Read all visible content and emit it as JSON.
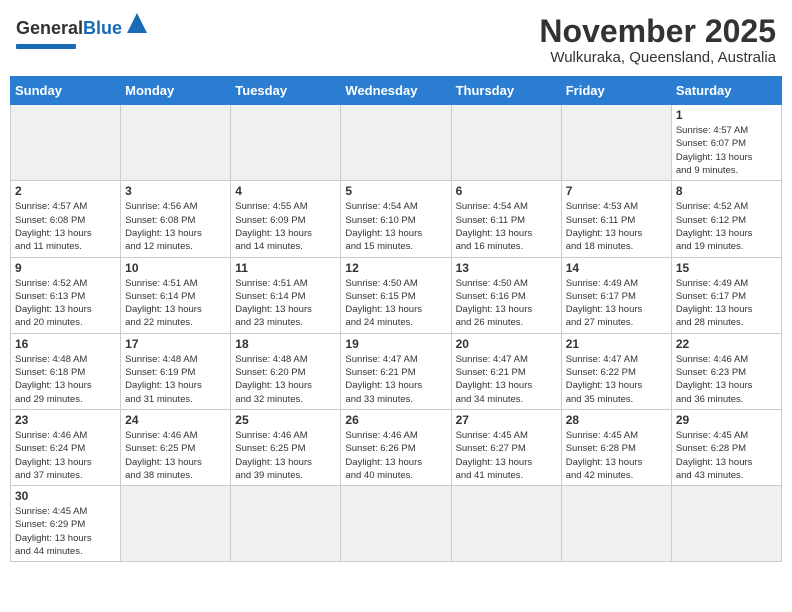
{
  "header": {
    "logo_general": "General",
    "logo_blue": "Blue",
    "month_title": "November 2025",
    "location": "Wulkuraka, Queensland, Australia"
  },
  "days_of_week": [
    "Sunday",
    "Monday",
    "Tuesday",
    "Wednesday",
    "Thursday",
    "Friday",
    "Saturday"
  ],
  "weeks": [
    [
      {
        "day": "",
        "empty": true
      },
      {
        "day": "",
        "empty": true
      },
      {
        "day": "",
        "empty": true
      },
      {
        "day": "",
        "empty": true
      },
      {
        "day": "",
        "empty": true
      },
      {
        "day": "",
        "empty": true
      },
      {
        "day": "1",
        "sunrise": "4:57 AM",
        "sunset": "6:07 PM",
        "daylight_hours": "13",
        "daylight_minutes": "9"
      }
    ],
    [
      {
        "day": "2",
        "sunrise": "4:57 AM",
        "sunset": "6:08 PM",
        "daylight_hours": "13",
        "daylight_minutes": "11"
      },
      {
        "day": "3",
        "sunrise": "4:56 AM",
        "sunset": "6:08 PM",
        "daylight_hours": "13",
        "daylight_minutes": "12"
      },
      {
        "day": "4",
        "sunrise": "4:55 AM",
        "sunset": "6:09 PM",
        "daylight_hours": "13",
        "daylight_minutes": "14"
      },
      {
        "day": "5",
        "sunrise": "4:54 AM",
        "sunset": "6:10 PM",
        "daylight_hours": "13",
        "daylight_minutes": "15"
      },
      {
        "day": "6",
        "sunrise": "4:54 AM",
        "sunset": "6:11 PM",
        "daylight_hours": "13",
        "daylight_minutes": "16"
      },
      {
        "day": "7",
        "sunrise": "4:53 AM",
        "sunset": "6:11 PM",
        "daylight_hours": "13",
        "daylight_minutes": "18"
      },
      {
        "day": "8",
        "sunrise": "4:52 AM",
        "sunset": "6:12 PM",
        "daylight_hours": "13",
        "daylight_minutes": "19"
      }
    ],
    [
      {
        "day": "9",
        "sunrise": "4:52 AM",
        "sunset": "6:13 PM",
        "daylight_hours": "13",
        "daylight_minutes": "20"
      },
      {
        "day": "10",
        "sunrise": "4:51 AM",
        "sunset": "6:14 PM",
        "daylight_hours": "13",
        "daylight_minutes": "22"
      },
      {
        "day": "11",
        "sunrise": "4:51 AM",
        "sunset": "6:14 PM",
        "daylight_hours": "13",
        "daylight_minutes": "23"
      },
      {
        "day": "12",
        "sunrise": "4:50 AM",
        "sunset": "6:15 PM",
        "daylight_hours": "13",
        "daylight_minutes": "24"
      },
      {
        "day": "13",
        "sunrise": "4:50 AM",
        "sunset": "6:16 PM",
        "daylight_hours": "13",
        "daylight_minutes": "26"
      },
      {
        "day": "14",
        "sunrise": "4:49 AM",
        "sunset": "6:17 PM",
        "daylight_hours": "13",
        "daylight_minutes": "27"
      },
      {
        "day": "15",
        "sunrise": "4:49 AM",
        "sunset": "6:17 PM",
        "daylight_hours": "13",
        "daylight_minutes": "28"
      }
    ],
    [
      {
        "day": "16",
        "sunrise": "4:48 AM",
        "sunset": "6:18 PM",
        "daylight_hours": "13",
        "daylight_minutes": "29"
      },
      {
        "day": "17",
        "sunrise": "4:48 AM",
        "sunset": "6:19 PM",
        "daylight_hours": "13",
        "daylight_minutes": "31"
      },
      {
        "day": "18",
        "sunrise": "4:48 AM",
        "sunset": "6:20 PM",
        "daylight_hours": "13",
        "daylight_minutes": "32"
      },
      {
        "day": "19",
        "sunrise": "4:47 AM",
        "sunset": "6:21 PM",
        "daylight_hours": "13",
        "daylight_minutes": "33"
      },
      {
        "day": "20",
        "sunrise": "4:47 AM",
        "sunset": "6:21 PM",
        "daylight_hours": "13",
        "daylight_minutes": "34"
      },
      {
        "day": "21",
        "sunrise": "4:47 AM",
        "sunset": "6:22 PM",
        "daylight_hours": "13",
        "daylight_minutes": "35"
      },
      {
        "day": "22",
        "sunrise": "4:46 AM",
        "sunset": "6:23 PM",
        "daylight_hours": "13",
        "daylight_minutes": "36"
      }
    ],
    [
      {
        "day": "23",
        "sunrise": "4:46 AM",
        "sunset": "6:24 PM",
        "daylight_hours": "13",
        "daylight_minutes": "37"
      },
      {
        "day": "24",
        "sunrise": "4:46 AM",
        "sunset": "6:25 PM",
        "daylight_hours": "13",
        "daylight_minutes": "38"
      },
      {
        "day": "25",
        "sunrise": "4:46 AM",
        "sunset": "6:25 PM",
        "daylight_hours": "13",
        "daylight_minutes": "39"
      },
      {
        "day": "26",
        "sunrise": "4:46 AM",
        "sunset": "6:26 PM",
        "daylight_hours": "13",
        "daylight_minutes": "40"
      },
      {
        "day": "27",
        "sunrise": "4:45 AM",
        "sunset": "6:27 PM",
        "daylight_hours": "13",
        "daylight_minutes": "41"
      },
      {
        "day": "28",
        "sunrise": "4:45 AM",
        "sunset": "6:28 PM",
        "daylight_hours": "13",
        "daylight_minutes": "42"
      },
      {
        "day": "29",
        "sunrise": "4:45 AM",
        "sunset": "6:28 PM",
        "daylight_hours": "13",
        "daylight_minutes": "43"
      }
    ],
    [
      {
        "day": "30",
        "sunrise": "4:45 AM",
        "sunset": "6:29 PM",
        "daylight_hours": "13",
        "daylight_minutes": "44"
      },
      {
        "day": "",
        "empty": true
      },
      {
        "day": "",
        "empty": true
      },
      {
        "day": "",
        "empty": true
      },
      {
        "day": "",
        "empty": true
      },
      {
        "day": "",
        "empty": true
      },
      {
        "day": "",
        "empty": true
      }
    ]
  ]
}
